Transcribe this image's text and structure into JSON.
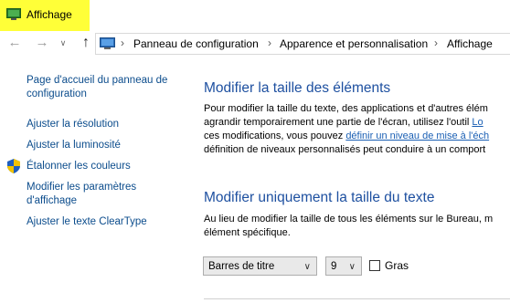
{
  "window": {
    "title": "Affichage"
  },
  "breadcrumb": [
    "Panneau de configuration",
    "Apparence et personnalisation",
    "Affichage"
  ],
  "sidebar": {
    "items": [
      {
        "label_lines": [
          "Page d'accueil du panneau de",
          "configuration"
        ]
      },
      {
        "label_lines": [
          "Ajuster la résolution"
        ]
      },
      {
        "label_lines": [
          "Ajuster la luminosité"
        ]
      },
      {
        "label_lines": [
          "Étalonner les couleurs"
        ]
      },
      {
        "label_lines": [
          "Modifier les paramètres",
          "d'affichage"
        ]
      },
      {
        "label_lines": [
          "Ajuster le texte ClearType"
        ]
      }
    ]
  },
  "main": {
    "section1": {
      "heading": "Modifier la taille des éléments",
      "line1": "Pour modifier la taille du texte, des applications et d'autres élém",
      "line2_prefix": "agrandir temporairement une partie de l'écran, utilisez l'outil ",
      "line2_link": "Lo",
      "line3_prefix": "ces modifications, vous pouvez ",
      "line3_link": "définir un niveau de mise à l'éch",
      "line4": "définition de niveaux personnalisés peut conduire à un comport"
    },
    "section2": {
      "heading": "Modifier uniquement la taille du texte",
      "line1": "Au lieu de modifier la taille de tous les éléments sur le Bureau, m",
      "line2": "élément spécifique.",
      "element_select": "Barres de titre",
      "size_select": "9",
      "bold_label": "Gras",
      "bold_checked": false
    }
  },
  "colors": {
    "title_highlight": "#ffff38",
    "heading": "#1e50a0",
    "link": "#1a3c7a"
  }
}
